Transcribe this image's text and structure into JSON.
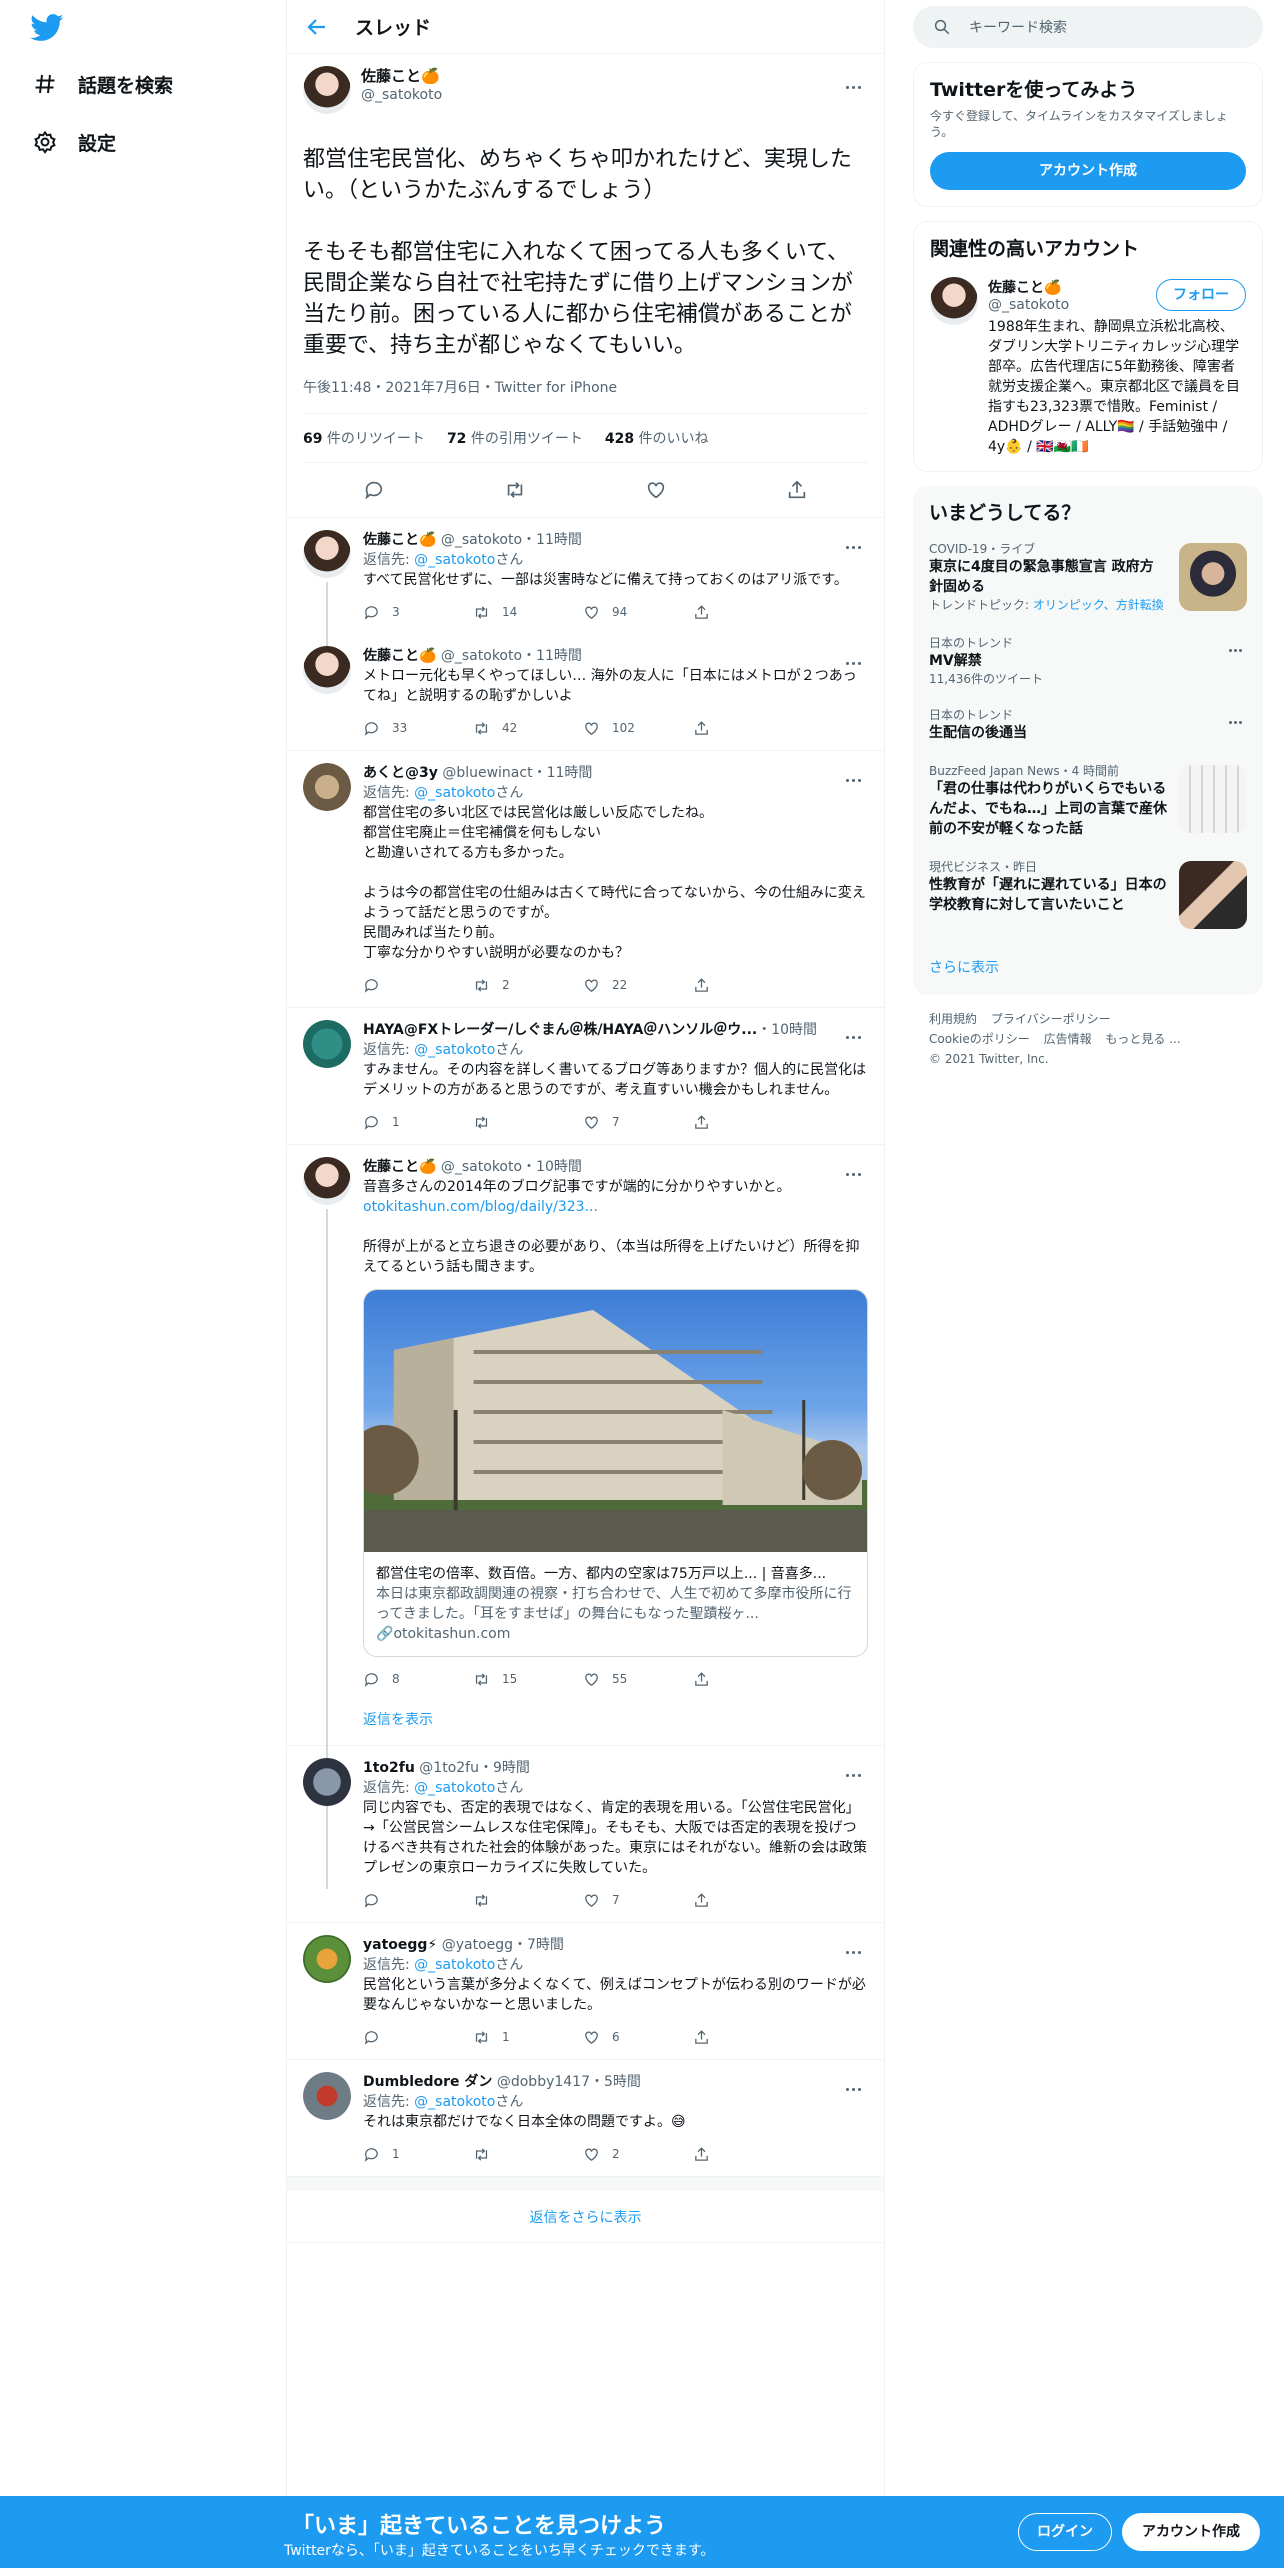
{
  "nav": {
    "explore": "話題を検索",
    "settings": "設定"
  },
  "header": {
    "title": "スレッド"
  },
  "main_tweet": {
    "name": "佐藤こと🍊",
    "handle": "@_satokoto",
    "text": "都営住宅民営化、めちゃくちゃ叩かれたけど、実現したい。（というかたぶんするでしょう）\n\nそもそも都営住宅に入れなくて困ってる人も多くいて、民間企業なら自社で社宅持たずに借り上げマンションが当たり前。困っている人に都から住宅補償があることが重要で、持ち主が都じゃなくてもいい。",
    "meta": "午後11:48・2021年7月6日・Twitter for iPhone",
    "retweets_count": "69",
    "retweets_label": " 件のリツイート",
    "quotes_count": "72",
    "quotes_label": " 件の引用ツイート",
    "likes_count": "428",
    "likes_label": " 件のいいね"
  },
  "replies": [
    {
      "name": "佐藤こと🍊",
      "meta": " @_satokoto・11時間",
      "reply_to": "返信先: ",
      "reply_to_user": "@_satokoto",
      "reply_to_suffix": "さん",
      "text": "すべて民営化せずに、一部は災害時などに備えて持っておくのはアリ派です。",
      "replies": "3",
      "retweets": "14",
      "likes": "94"
    },
    {
      "name": "佐藤こと🍊",
      "meta": " @_satokoto・11時間",
      "text": "メトロー元化も早くやってほしい… 海外の友人に「日本にはメトロが２つあってね」と説明するの恥ずかしいよ",
      "replies": "33",
      "retweets": "42",
      "likes": "102"
    },
    {
      "name": "あくと@3y",
      "meta": " @bluewinact・11時間",
      "reply_to": "返信先: ",
      "reply_to_user": "@_satokoto",
      "reply_to_suffix": "さん",
      "text": "都営住宅の多い北区では民営化は厳しい反応でしたね。\n都営住宅廃止＝住宅補償を何もしない\nと勘違いされてる方も多かった。\n\nようは今の都営住宅の仕組みは古くて時代に合ってないから、今の仕組みに変えようって話だと思うのですが。\n民間みれば当たり前。\n丁寧な分かりやすい説明が必要なのかも？",
      "replies": "",
      "retweets": "2",
      "likes": "22"
    },
    {
      "name": "HAYA@FXトレーダー/しぐまん＠株/HAYA＠ハンソル＠ウ...",
      "meta": "・10時間",
      "reply_to": "返信先: ",
      "reply_to_user": "@_satokoto",
      "reply_to_suffix": "さん",
      "text": "すみません。その内容を詳しく書いてるブログ等ありますか？個人的に民営化はデメリットの方があると思うのですが、考え直すいい機会かもしれません。",
      "replies": "1",
      "retweets": "",
      "likes": "7"
    },
    {
      "name": "佐藤こと🍊",
      "meta": " @_satokoto・10時間",
      "text_1": "音喜多さんの2014年のブログ記事ですが端的に分かりやすいかと。",
      "link": "otokitashun.com/blog/daily/323...",
      "text_2": "所得が上がると立ち退きの必要があり、（本当は所得を上げたいけど）所得を抑えてるという話も聞きます。",
      "card_title": "都営住宅の倍率、数百倍。一方、都内の空家は75万戸以上... | 音喜多...",
      "card_desc": "本日は東京都政調関連の視察・打ち合わせで、人生で初めて多摩市役所に行ってきました。「耳をすませば」の舞台にもなった聖蹟桜ヶ...",
      "card_domain": "otokitashun.com",
      "replies": "8",
      "retweets": "15",
      "likes": "55",
      "show_replies": "返信を表示"
    },
    {
      "name": "1to2fu",
      "meta": " @1to2fu・9時間",
      "reply_to": "返信先: ",
      "reply_to_user": "@_satokoto",
      "reply_to_suffix": "さん",
      "text": "同じ内容でも、否定的表現ではなく、肯定的表現を用いる。「公営住宅民営化」→「公営民営シームレスな住宅保障」。そもそも、大阪では否定的表現を投げつけるべき共有された社会的体験があった。東京にはそれがない。維新の会は政策プレゼンの東京ローカライズに失敗していた。",
      "replies": "",
      "retweets": "",
      "likes": "7"
    },
    {
      "name": "yatoegg⚡",
      "meta": " @yatoegg・7時間",
      "reply_to": "返信先: ",
      "reply_to_user": "@_satokoto",
      "reply_to_suffix": "さん",
      "text": "民営化という言葉が多分よくなくて、例えばコンセプトが伝わる別のワードが必要なんじゃないかなーと思いました。",
      "replies": "",
      "retweets": "1",
      "likes": "6"
    },
    {
      "name": "Dumbledore ダン",
      "meta": " @dobby1417・5時間",
      "reply_to": "返信先: ",
      "reply_to_user": "@_satokoto",
      "reply_to_suffix": "さん",
      "text": "それは東京都だけでなく日本全体の問題ですよ。😅",
      "replies": "1",
      "retweets": "",
      "likes": "2"
    }
  ],
  "more_replies": "返信をさらに表示",
  "search": {
    "placeholder": "キーワード検索"
  },
  "signup_box": {
    "title": "Twitterを使ってみよう",
    "sub": "今すぐ登録して、タイムラインをカスタマイズしましょう。",
    "button": "アカウント作成"
  },
  "related": {
    "title": "関連性の高いアカウント",
    "name": "佐藤こと🍊",
    "handle": "@_satokoto",
    "follow": "フォロー",
    "bio": "1988年生まれ、静岡県立浜松北高校、ダブリン大学トリニティカレッジ心理学部卒。広告代理店に5年勤務後、障害者就労支援企業へ。東京都北区で議員を目指すも23,323票で惜敗。Feminist / ADHDグレー / ALLY🏳️‍🌈 / 手話勉強中 / 4y👶 / 🇬🇧🏴󠁧󠁢󠁷󠁬󠁳󠁿🇮🇪"
  },
  "trends": {
    "title": "いまどうしてる？",
    "items": [
      {
        "ctx": "COVID-19・ライブ",
        "name": "東京に4度目の緊急事態宣言 政府方針固める",
        "sub_prefix": "トレンドトピック: ",
        "sub_link": "オリンピック、方針転換"
      },
      {
        "ctx": "日本のトレンド",
        "name": "MV解禁",
        "sub": "11,436件のツイート"
      },
      {
        "ctx": "日本のトレンド",
        "name": "生配信の後通当"
      },
      {
        "ctx": "BuzzFeed Japan News・4 時間前",
        "name": "「君の仕事は代わりがいくらでもいるんだよ、でもね…」上司の言葉で産休前の不安が軽くなった話"
      },
      {
        "ctx": "現代ビジネス・昨日",
        "name": "性教育が「遅れに遅れている」日本の学校教育に対して言いたいこと"
      }
    ],
    "show_more": "さらに表示"
  },
  "footer": {
    "links": [
      "利用規約",
      "プライバシーポリシー",
      "Cookieのポリシー",
      "広告情報",
      "もっと見る ..."
    ],
    "copyright": "© 2021 Twitter, Inc."
  },
  "bottom_bar": {
    "title": "「いま」起きていることを見つけよう",
    "sub": "Twitterなら、「いま」起きていることをいち早くチェックできます。",
    "login": "ログイン",
    "signup": "アカウント作成"
  },
  "colors": {
    "accent": "#1d9bf0",
    "text": "#0f1419",
    "muted": "#536471",
    "border": "#eff3f4"
  }
}
